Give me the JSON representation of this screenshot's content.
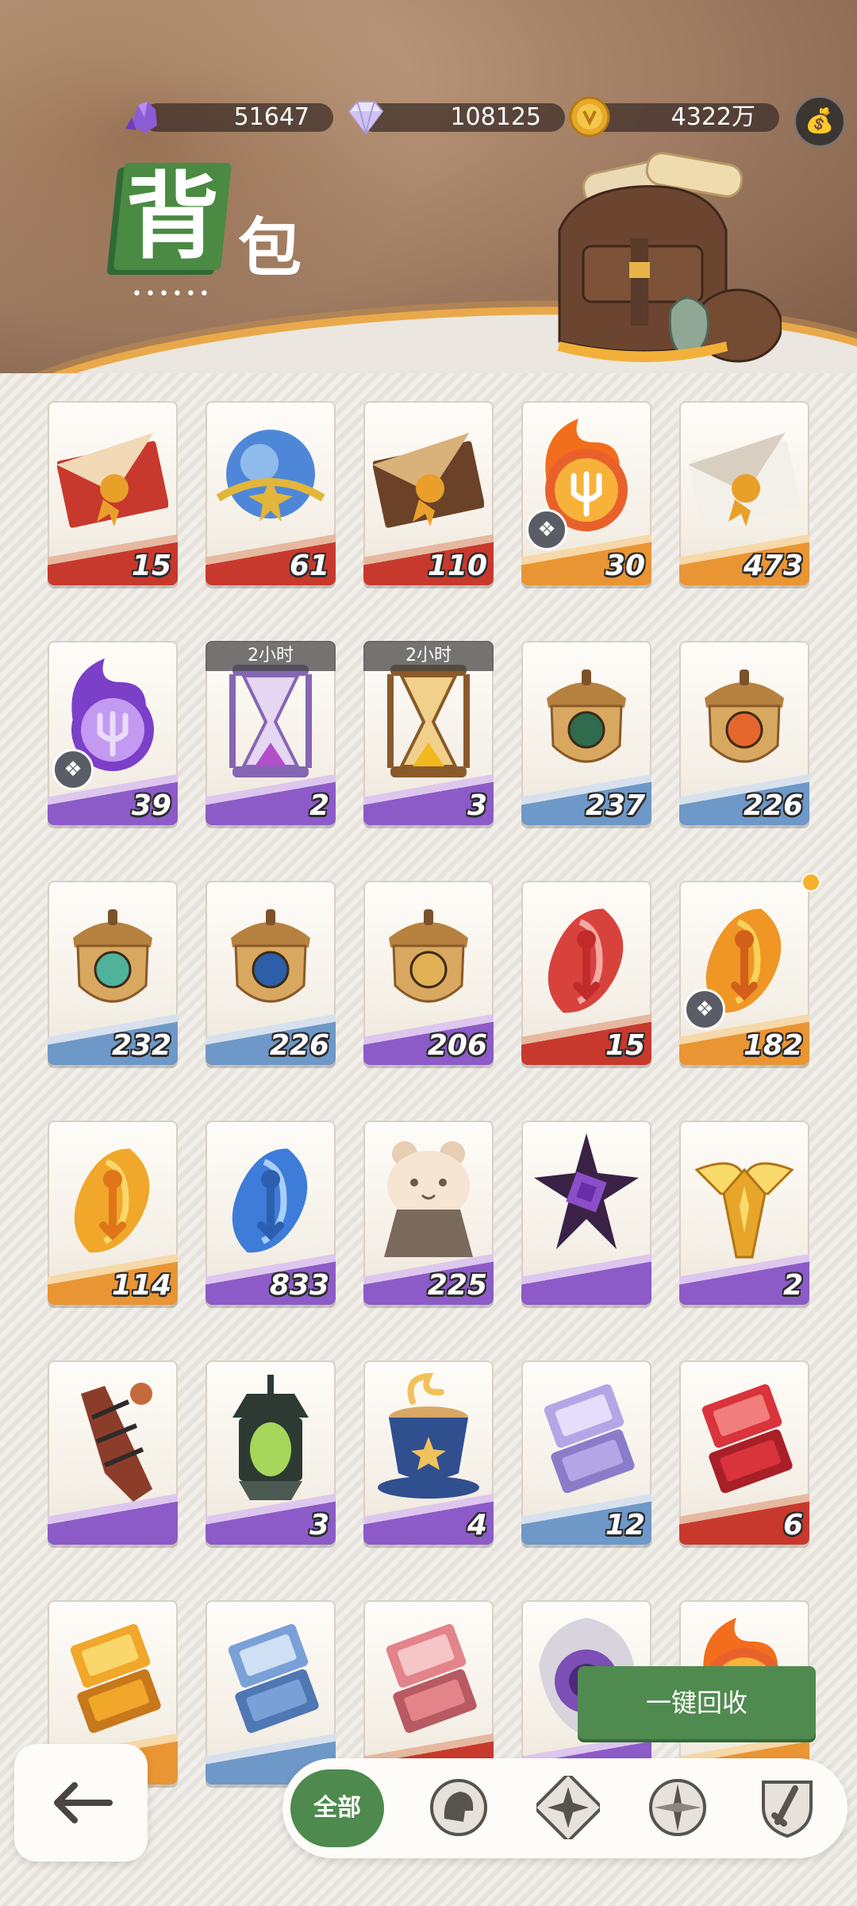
{
  "currencies": [
    {
      "name": "purple-crystal",
      "value": "51647"
    },
    {
      "name": "diamond",
      "value": "108125"
    },
    {
      "name": "gold-coin",
      "value": "4322万"
    }
  ],
  "title": {
    "big": "背",
    "small": "包",
    "dots": "••••••"
  },
  "money_bag_icon": "money-bag-icon",
  "items": [
    {
      "name": "red-envelope-letter",
      "count": "15",
      "band": "red",
      "art": "envelope-red"
    },
    {
      "name": "blue-orb-star",
      "count": "61",
      "band": "red",
      "art": "orb-blue"
    },
    {
      "name": "brown-envelope-letter",
      "count": "110",
      "band": "red",
      "art": "envelope-brown"
    },
    {
      "name": "fire-trident-coin",
      "count": "30",
      "band": "orange",
      "art": "fire-coin",
      "puzzle": true
    },
    {
      "name": "white-envelope-letter",
      "count": "473",
      "band": "orange",
      "art": "envelope-white"
    },
    {
      "name": "purple-flame-trident",
      "count": "39",
      "band": "purple",
      "art": "purple-flame",
      "puzzle": true
    },
    {
      "name": "purple-hourglass",
      "count": "2",
      "band": "purple",
      "art": "hourglass-purple",
      "timer": "2小时"
    },
    {
      "name": "gold-hourglass",
      "count": "3",
      "band": "purple",
      "art": "hourglass-gold",
      "timer": "2小时"
    },
    {
      "name": "acorn-badge-green-eye",
      "count": "237",
      "band": "blue",
      "art": "acorn-green"
    },
    {
      "name": "acorn-badge-orange-sun",
      "count": "226",
      "band": "blue",
      "art": "acorn-orange"
    },
    {
      "name": "acorn-badge-leaf",
      "count": "232",
      "band": "blue",
      "art": "acorn-leaf"
    },
    {
      "name": "acorn-badge-star",
      "count": "226",
      "band": "blue",
      "art": "acorn-star"
    },
    {
      "name": "acorn-badge-gold",
      "count": "206",
      "band": "purple",
      "art": "acorn-gold"
    },
    {
      "name": "red-gem-key",
      "count": "15",
      "band": "red",
      "art": "gem-red"
    },
    {
      "name": "orange-gem-key",
      "count": "182",
      "band": "orange",
      "art": "gem-orange",
      "puzzle": true,
      "dot": true
    },
    {
      "name": "yellow-gem-key",
      "count": "114",
      "band": "orange",
      "art": "gem-yellow"
    },
    {
      "name": "blue-gem-key",
      "count": "833",
      "band": "purple",
      "art": "gem-blue"
    },
    {
      "name": "hamster-figure",
      "count": "225",
      "band": "purple",
      "art": "hamster"
    },
    {
      "name": "dark-crystal-star",
      "count": "",
      "band": "purple",
      "art": "dark-star"
    },
    {
      "name": "golden-winged-amulet",
      "count": "2",
      "band": "purple",
      "art": "winged-amulet"
    },
    {
      "name": "wrapped-totem",
      "count": "",
      "band": "purple",
      "art": "totem"
    },
    {
      "name": "green-lantern",
      "count": "3",
      "band": "purple",
      "art": "lantern"
    },
    {
      "name": "coffee-cup",
      "count": "4",
      "band": "purple",
      "art": "coffee"
    },
    {
      "name": "purple-bars",
      "count": "12",
      "band": "blue",
      "art": "bars-purple"
    },
    {
      "name": "red-bars",
      "count": "6",
      "band": "red",
      "art": "bars-red"
    },
    {
      "name": "gold-bars",
      "count": "",
      "band": "orange",
      "art": "bars-gold"
    },
    {
      "name": "blue-bars",
      "count": "",
      "band": "blue",
      "art": "bars-blue"
    },
    {
      "name": "pink-bars",
      "count": "",
      "band": "red",
      "art": "bars-pink"
    },
    {
      "name": "purple-rune-shield",
      "count": "",
      "band": "purple",
      "art": "rune-shield"
    },
    {
      "name": "fire-item",
      "count": "",
      "band": "orange",
      "art": "fire-coin"
    }
  ],
  "recycle_button": "一键回收",
  "tabs": {
    "all_label": "全部",
    "icons": [
      "helmet-icon",
      "star-badge-icon",
      "compass-icon",
      "sword-shield-icon"
    ]
  },
  "colors": {
    "accent_green": "#4e8a4e",
    "header_brown": "#7b5a45",
    "count_outline": "#2b2b2b"
  }
}
